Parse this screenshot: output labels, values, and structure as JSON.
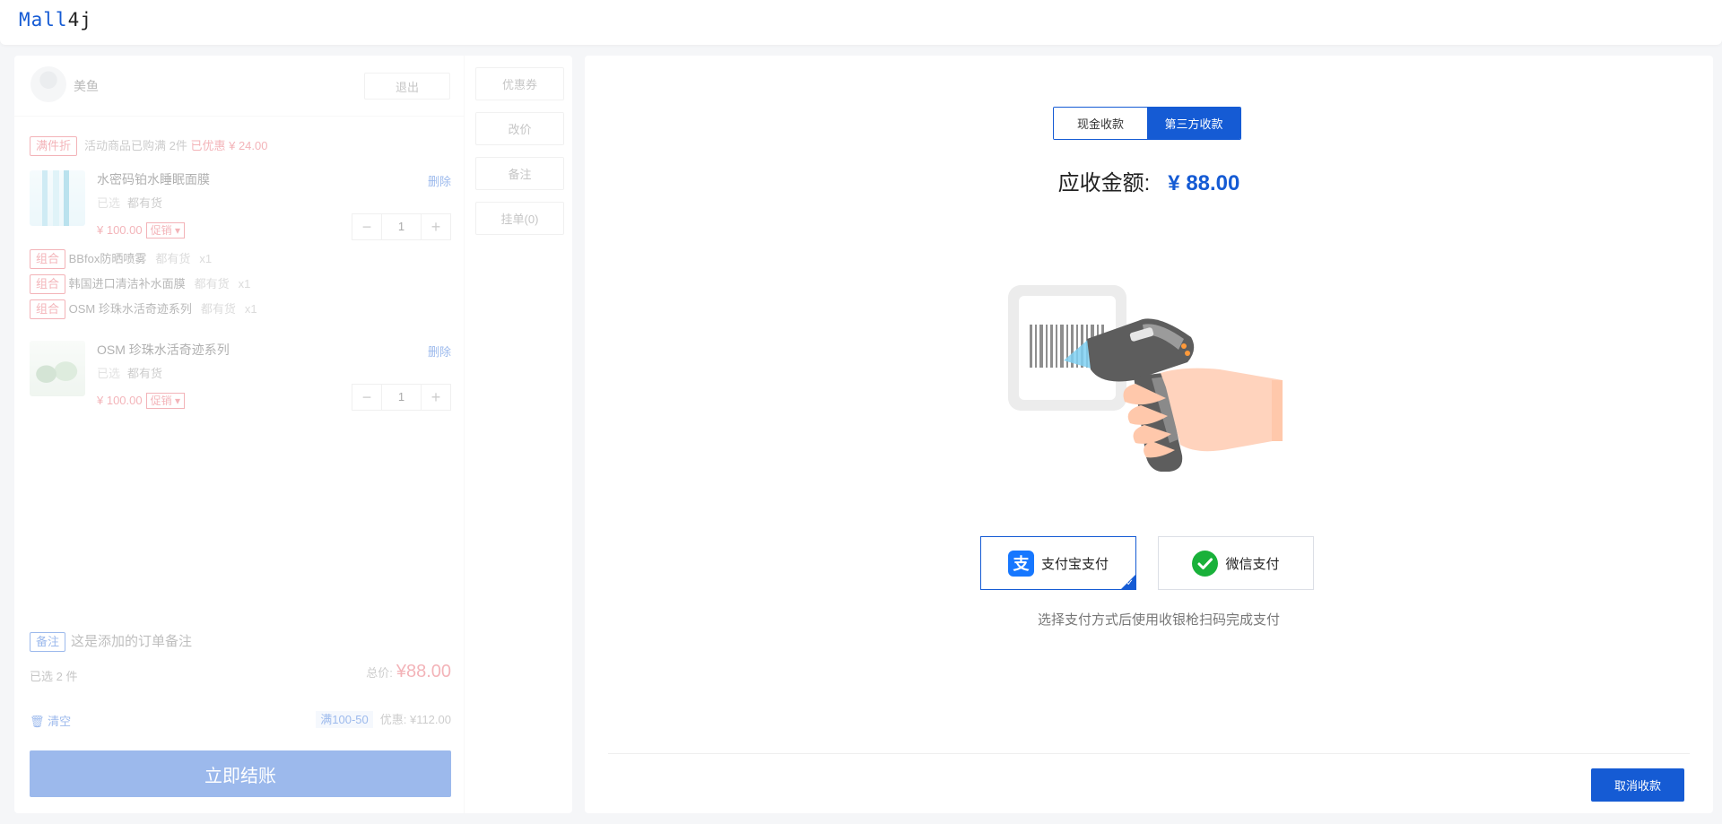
{
  "app": {
    "logo_part1": "Mall",
    "logo_part2": "4j"
  },
  "user": {
    "name": "美鱼",
    "logout_label": "退出"
  },
  "promotion": {
    "tag": "满件折",
    "text": "活动商品已购满 2件",
    "discount": "已优惠 ¥ 24.00"
  },
  "products": [
    {
      "name": "水密码铂水睡眠面膜",
      "delete_label": "删除",
      "selected_label": "已选",
      "stock": "都有货",
      "price": "¥ 100.00",
      "promo_label": "促销",
      "quantity": "1"
    },
    {
      "name": "OSM 珍珠水活奇迹系列",
      "delete_label": "删除",
      "selected_label": "已选",
      "stock": "都有货",
      "price": "¥ 100.00",
      "promo_label": "促销",
      "quantity": "1"
    }
  ],
  "combos": [
    {
      "tag": "组合",
      "name": "BBfox防晒喷雾",
      "stock": "都有货",
      "qty": "x1"
    },
    {
      "tag": "组合",
      "name": "韩国进口清洁补水面膜",
      "stock": "都有货",
      "qty": "x1"
    },
    {
      "tag": "组合",
      "name": "OSM 珍珠水活奇迹系列",
      "stock": "都有货",
      "qty": "x1"
    }
  ],
  "stepper": {
    "minus": "−",
    "plus": "+"
  },
  "summary": {
    "remark_tag": "备注",
    "remark_text": "这是添加的订单备注",
    "selected_count": "已选 2 件",
    "total_label": "总价:",
    "total_value": "¥88.00",
    "clear_label": "清空",
    "coupon_chip": "满100-50",
    "discount_text": "优惠: ¥112.00",
    "checkout_label": "立即结账"
  },
  "side_actions": {
    "coupon": "优惠券",
    "change_price": "改价",
    "remark": "备注",
    "hang_order": "挂单(0)"
  },
  "payment": {
    "tab_cash": "现金收款",
    "tab_third_party": "第三方收款",
    "amount_label": "应收金额:",
    "amount_value": "¥ 88.00",
    "alipay_label": "支付宝支付",
    "wechat_label": "微信支付",
    "hint": "选择支付方式后使用收银枪扫码完成支付",
    "cancel_label": "取消收款"
  },
  "colors": {
    "primary": "#155bd4",
    "danger": "#e34d59",
    "wechat": "#19b13a",
    "alipay": "#1677ff"
  }
}
